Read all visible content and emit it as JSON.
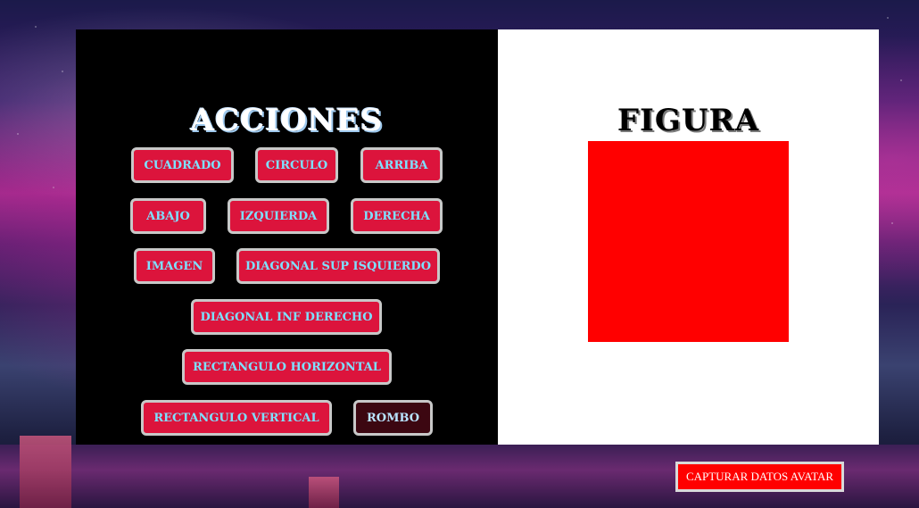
{
  "acciones": {
    "title": "ACCIONES",
    "buttons": {
      "cuadrado": "CUADRADO",
      "circulo": "CIRCULO",
      "arriba": "ARRIBA",
      "abajo": "ABAJO",
      "izquierda": "IZQUIERDA",
      "derecha": "DERECHA",
      "imagen": "IMAGEN",
      "diag_sup": "DIAGONAL SUP ISQUIERDO",
      "diag_inf": "DIAGONAL INF DERECHO",
      "rect_h": "RECTANGULO HORIZONTAL",
      "rect_v": "RECTANGULO VERTICAL",
      "rombo": "ROMBO"
    }
  },
  "figura": {
    "title": "FIGURA",
    "shape_color": "#ff0000"
  },
  "capture_button": "CAPTURAR DATOS AVATAR",
  "colors": {
    "button_bg": "#dc143c",
    "button_text": "#7ee0ff",
    "selected_button_bg": "#3c0711"
  }
}
